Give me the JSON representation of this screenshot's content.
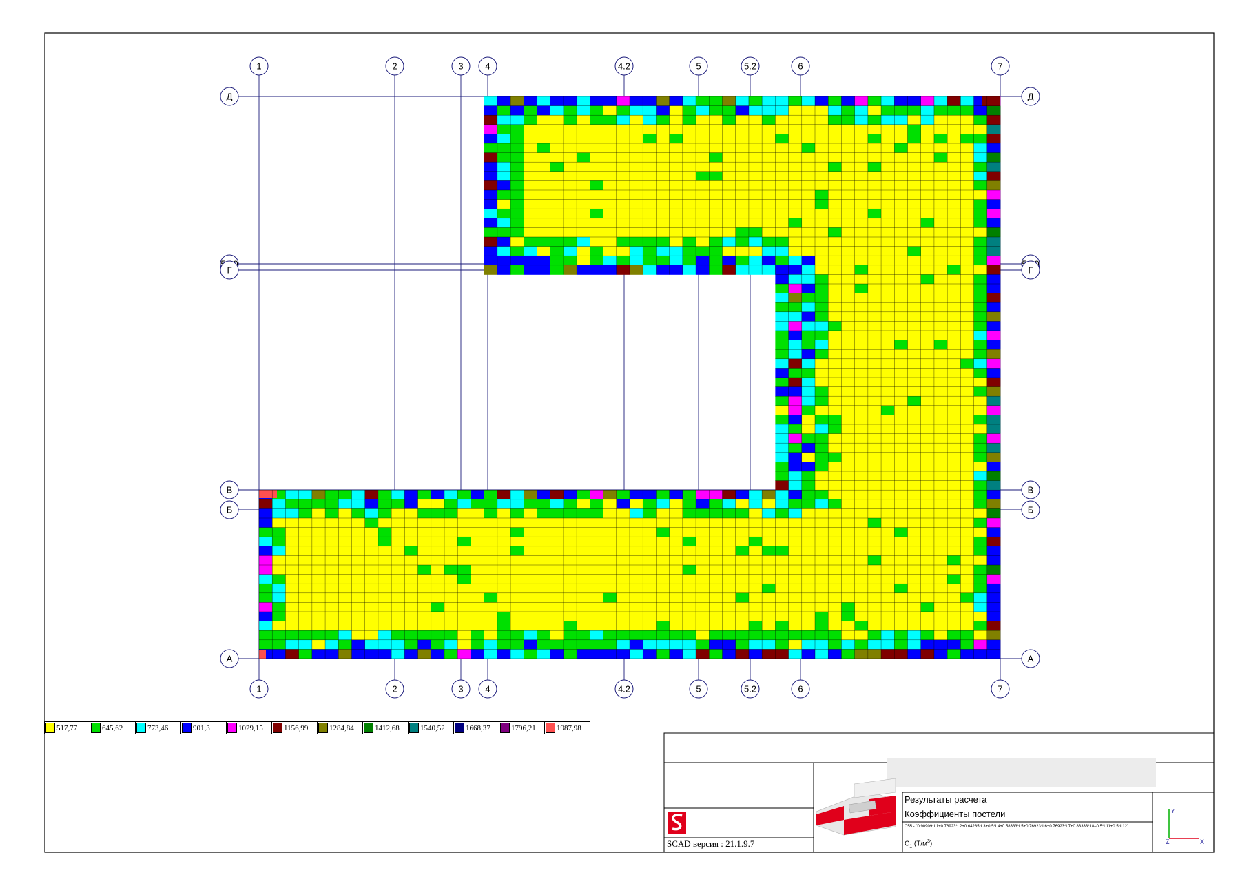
{
  "axes": {
    "vertical": [
      "1",
      "2",
      "3",
      "4",
      "4.2",
      "5",
      "5.2",
      "6",
      "7"
    ],
    "horizontal": [
      "Д",
      "5.10",
      "Г",
      "В",
      "Б",
      "А"
    ]
  },
  "legend": [
    {
      "value": "517,77",
      "color": "#ffff00"
    },
    {
      "value": "645,62",
      "color": "#00e000"
    },
    {
      "value": "773,46",
      "color": "#00ffff"
    },
    {
      "value": "901,3",
      "color": "#0000ff"
    },
    {
      "value": "1029,15",
      "color": "#ff00ff"
    },
    {
      "value": "1156,99",
      "color": "#800000"
    },
    {
      "value": "1284,84",
      "color": "#808000"
    },
    {
      "value": "1412,68",
      "color": "#008000"
    },
    {
      "value": "1540,52",
      "color": "#008080"
    },
    {
      "value": "1668,37",
      "color": "#000080"
    },
    {
      "value": "1796,21",
      "color": "#800080"
    },
    {
      "value": "1987,98",
      "color": "#ff5050"
    }
  ],
  "titleblock": {
    "title_line1": "Результаты расчета",
    "title_line2": "Коэффициенты постели",
    "combination": "C55 - \"0.90909*L1+0.76923*L2+0.64285*L3+0.5*L4+0.58333*L5+0.76923*L6+0.76923*L7+0.83333*L8–0.5*L11+0.5*L12\"",
    "units": "C",
    "units_sub": "1",
    "units_tail": " (Т/м",
    "units_sup": "3",
    "units_close": ")",
    "version": "SCAD версия : 21.1.9.7",
    "logo_letter": "S",
    "axis_x": "X",
    "axis_y": "Y",
    "axis_z": "Z"
  },
  "colors": {
    "grid_line": "#1a1a7a",
    "mesh_line": "#000000",
    "brand_red": "#e0001b"
  }
}
